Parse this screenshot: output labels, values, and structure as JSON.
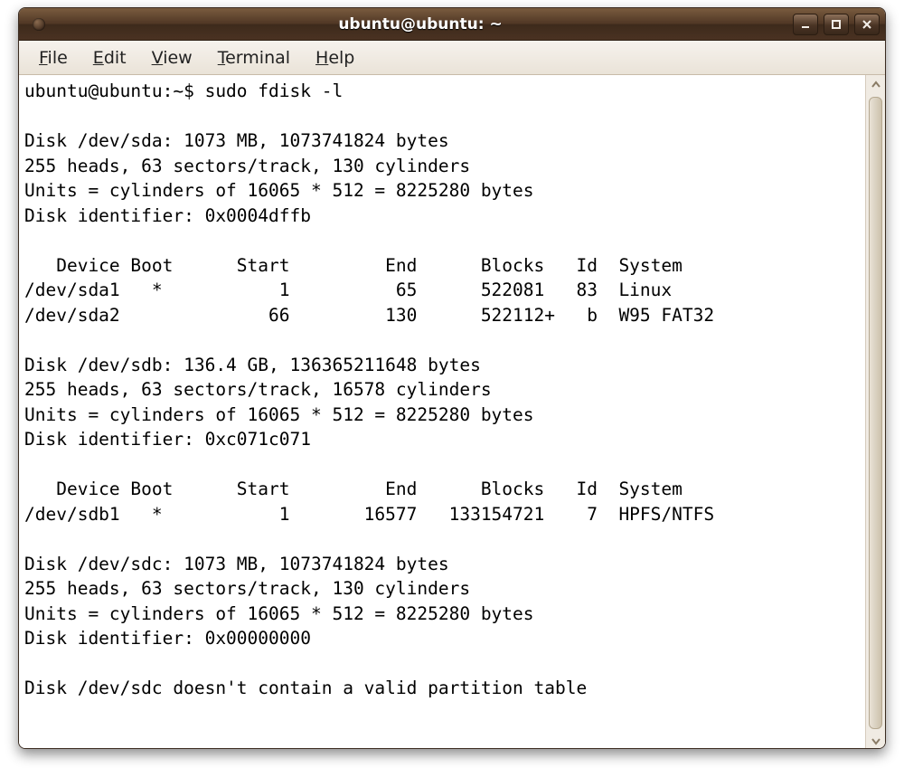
{
  "window": {
    "title": "ubuntu@ubuntu: ~"
  },
  "menubar": {
    "file": {
      "label": "File",
      "accel": "F"
    },
    "edit": {
      "label": "Edit",
      "accel": "E"
    },
    "view": {
      "label": "View",
      "accel": "V"
    },
    "terminal": {
      "label": "Terminal",
      "accel": "T"
    },
    "help": {
      "label": "Help",
      "accel": "H"
    }
  },
  "terminal": {
    "prompt": "ubuntu@ubuntu:~$ ",
    "command": "sudo fdisk -l",
    "disks": [
      {
        "header": "Disk /dev/sda: 1073 MB, 1073741824 bytes",
        "geom": "255 heads, 63 sectors/track, 130 cylinders",
        "units": "Units = cylinders of 16065 * 512 = 8225280 bytes",
        "ident": "Disk identifier: 0x0004dffb",
        "table_header": "   Device Boot      Start         End      Blocks   Id  System",
        "rows": [
          "/dev/sda1   *           1          65      522081   83  Linux",
          "/dev/sda2              66         130      522112+   b  W95 FAT32"
        ]
      },
      {
        "header": "Disk /dev/sdb: 136.4 GB, 136365211648 bytes",
        "geom": "255 heads, 63 sectors/track, 16578 cylinders",
        "units": "Units = cylinders of 16065 * 512 = 8225280 bytes",
        "ident": "Disk identifier: 0xc071c071",
        "table_header": "   Device Boot      Start         End      Blocks   Id  System",
        "rows": [
          "/dev/sdb1   *           1       16577   133154721    7  HPFS/NTFS"
        ]
      },
      {
        "header": "Disk /dev/sdc: 1073 MB, 1073741824 bytes",
        "geom": "255 heads, 63 sectors/track, 130 cylinders",
        "units": "Units = cylinders of 16065 * 512 = 8225280 bytes",
        "ident": "Disk identifier: 0x00000000",
        "note": "Disk /dev/sdc doesn't contain a valid partition table"
      }
    ]
  }
}
